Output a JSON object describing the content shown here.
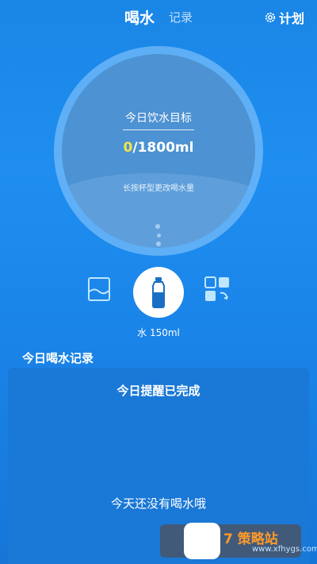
{
  "header": {
    "tab_active": "喝水",
    "tab_inactive": "记录",
    "plan_label": "计划"
  },
  "goal": {
    "title": "今日饮水目标",
    "current": "0",
    "total": "/1800ml",
    "hint": "长按杯型更改喝水量"
  },
  "cup_selector": {
    "selected_label": "水 150ml"
  },
  "records": {
    "section_title": "今日喝水记录",
    "reminder_status": "今日提醒已完成",
    "empty_message": "今天还没有喝水哦"
  },
  "watermark": {
    "text": "7 策略站",
    "url": "www.xfhygs.com"
  },
  "colors": {
    "accent_yellow": "#f2e54a",
    "background": "#1a86e6",
    "ring": "#4d92d2"
  }
}
